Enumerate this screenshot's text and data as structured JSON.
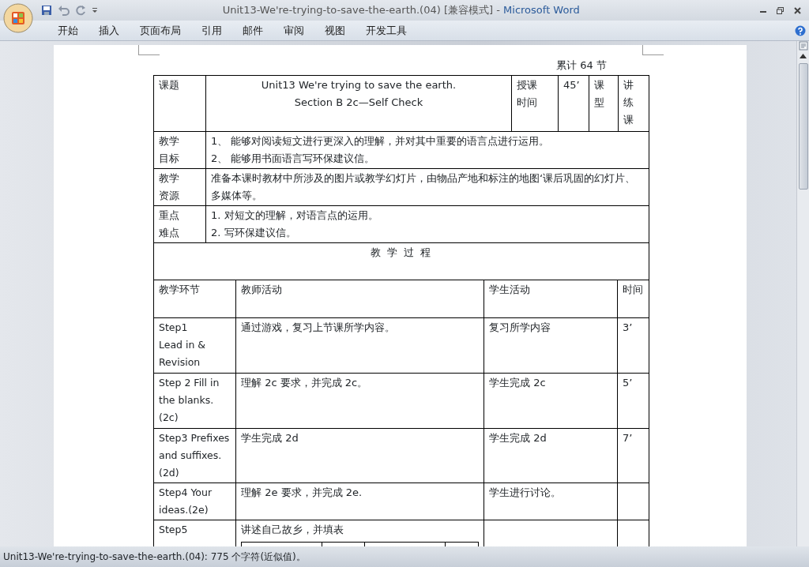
{
  "window": {
    "title": "Unit13-We're-trying-to-save-the-earth.(04) [兼容模式]",
    "separator": "-",
    "app": "Microsoft Word"
  },
  "ribbon_tabs": [
    {
      "label": "开始"
    },
    {
      "label": "插入"
    },
    {
      "label": "页面布局"
    },
    {
      "label": "引用"
    },
    {
      "label": "邮件"
    },
    {
      "label": "审阅"
    },
    {
      "label": "视图"
    },
    {
      "label": "开发工具"
    }
  ],
  "document": {
    "header_note": "累计 64 节",
    "lesson_table": {
      "title_label": "课题",
      "title_lines": [
        "Unit13 We're trying to save the earth.",
        "Section B 2c—Self Check"
      ],
      "time_label_lines": [
        "授课",
        "时间"
      ],
      "time": "45’",
      "type_label_lines": [
        "课",
        "型"
      ],
      "type_lines": [
        "讲",
        "练",
        "课"
      ],
      "rows": [
        {
          "label_lines": [
            "教学",
            "目标"
          ],
          "lines": [
            "1、 能够对阅读短文进行更深入的理解，并对其中重要的语言点进行运用。",
            "2、 能够用书面语言写环保建议信。"
          ]
        },
        {
          "label_lines": [
            "教学",
            "资源"
          ],
          "lines": [
            "准备本课时教材中所涉及的图片或教学幻灯片，由物品产地和标注的地图‘课后巩固的幻灯片、多媒体等。"
          ]
        },
        {
          "label_lines": [
            "重点",
            "难点"
          ],
          "lines": [
            "1.   对短文的理解，对语言点的运用。",
            "2.   写环保建议信。"
          ]
        }
      ],
      "section_heading": "教 学 过 程"
    },
    "process_table": {
      "columns": [
        "教学环节",
        "教师活动",
        "学生活动",
        "时间"
      ],
      "rows": [
        {
          "step_lines": [
            "Step1",
            "Lead in &",
            "Revision"
          ],
          "teacher": "通过游戏，复习上节课所学内容。",
          "student": "复习所学内容",
          "time": "3’"
        },
        {
          "step_lines": [
            "Step 2 Fill in",
            "the blanks.",
            "(2c)"
          ],
          "teacher": "理解 2c 要求，并完成 2c。",
          "student": "学生完成 2c",
          "time": "5’"
        },
        {
          "step_lines": [
            "Step3 Prefixes",
            "and suffixes.",
            "(2d)"
          ],
          "teacher": "学生完成 2d",
          "student": "学生完成 2d",
          "time": "7’"
        },
        {
          "step_lines": [
            "Step4 Your",
            "ideas.(2e)"
          ],
          "teacher": "理解 2e 要求，并完成 2e.",
          "student": "学生进行讨论。"
        },
        {
          "step_lines": [
            "Step5"
          ],
          "teacher": "讲述自己故乡，并填表",
          "inner_table": true
        }
      ]
    }
  },
  "status_bar": {
    "text": "Unit13-We're-trying-to-save-the-earth.(04): 775 个字符(近似值)。"
  }
}
